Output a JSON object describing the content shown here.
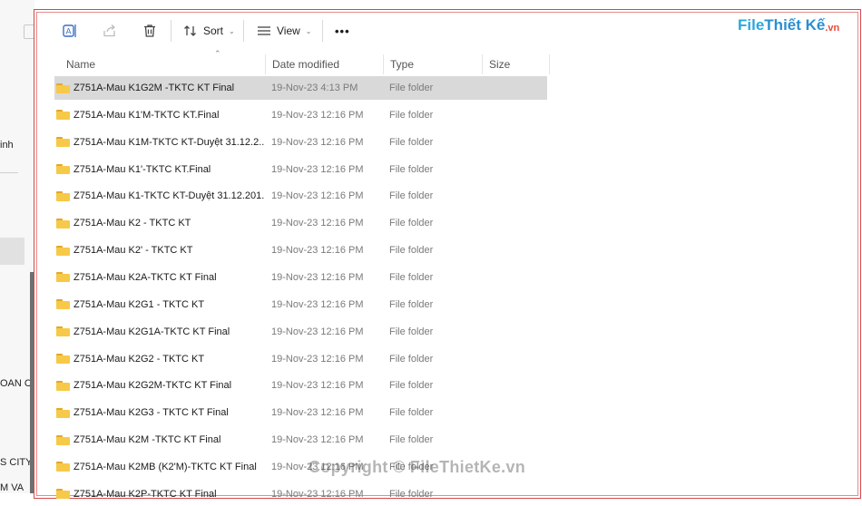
{
  "sidebar": {
    "fragments": [
      "inh",
      "OAN C",
      "S CITY",
      "M VA"
    ]
  },
  "toolbar": {
    "sort_label": "Sort",
    "view_label": "View",
    "more_label": "•••"
  },
  "logo": {
    "part1": "File",
    "part2": "Thiết Kế",
    "part3": ".vn"
  },
  "columns": {
    "name": "Name",
    "date": "Date modified",
    "type": "Type",
    "size": "Size"
  },
  "rows": [
    {
      "name": "Z751A-Mau K1G2M -TKTC KT Final",
      "date": "19-Nov-23 4:13 PM",
      "type": "File folder"
    },
    {
      "name": "Z751A-Mau K1'M-TKTC KT.Final",
      "date": "19-Nov-23 12:16 PM",
      "type": "File folder"
    },
    {
      "name": "Z751A-Mau K1M-TKTC KT-Duyệt 31.12.2...",
      "date": "19-Nov-23 12:16 PM",
      "type": "File folder"
    },
    {
      "name": "Z751A-Mau K1'-TKTC KT.Final",
      "date": "19-Nov-23 12:16 PM",
      "type": "File folder"
    },
    {
      "name": "Z751A-Mau K1-TKTC KT-Duyệt 31.12.201...",
      "date": "19-Nov-23 12:16 PM",
      "type": "File folder"
    },
    {
      "name": "Z751A-Mau K2 - TKTC KT",
      "date": "19-Nov-23 12:16 PM",
      "type": "File folder"
    },
    {
      "name": "Z751A-Mau K2' - TKTC KT",
      "date": "19-Nov-23 12:16 PM",
      "type": "File folder"
    },
    {
      "name": "Z751A-Mau K2A-TKTC KT Final",
      "date": "19-Nov-23 12:16 PM",
      "type": "File folder"
    },
    {
      "name": "Z751A-Mau K2G1 - TKTC KT",
      "date": "19-Nov-23 12:16 PM",
      "type": "File folder"
    },
    {
      "name": "Z751A-Mau K2G1A-TKTC KT Final",
      "date": "19-Nov-23 12:16 PM",
      "type": "File folder"
    },
    {
      "name": "Z751A-Mau K2G2 - TKTC KT",
      "date": "19-Nov-23 12:16 PM",
      "type": "File folder"
    },
    {
      "name": "Z751A-Mau K2G2M-TKTC KT Final",
      "date": "19-Nov-23 12:16 PM",
      "type": "File folder"
    },
    {
      "name": "Z751A-Mau K2G3 - TKTC KT Final",
      "date": "19-Nov-23 12:16 PM",
      "type": "File folder"
    },
    {
      "name": "Z751A-Mau K2M -TKTC KT Final",
      "date": "19-Nov-23 12:16 PM",
      "type": "File folder"
    },
    {
      "name": "Z751A-Mau K2MB (K2'M)-TKTC KT Final",
      "date": "19-Nov-23 12:16 PM",
      "type": "File folder"
    },
    {
      "name": "Z751A-Mau K2P-TKTC KT Final",
      "date": "19-Nov-23 12:16 PM",
      "type": "File folder"
    }
  ],
  "watermark": "Copyright © FileThietKe.vn",
  "colors": {
    "selected_row": "#d9d9d9",
    "frame_red": "#d34a4a",
    "folder_yellow": "#f7c948"
  }
}
